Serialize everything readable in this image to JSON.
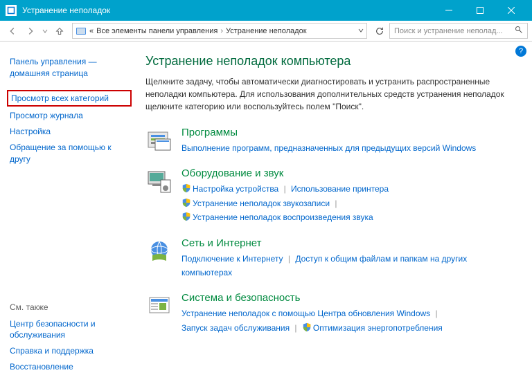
{
  "titlebar": {
    "title": "Устранение неполадок"
  },
  "navbar": {
    "breadcrumb0_sep": "«",
    "breadcrumb1": "Все элементы панели управления",
    "breadcrumb2": "Устранение неполадок",
    "search_placeholder": "Поиск и устранение неполад..."
  },
  "sidebar": {
    "home": "Панель управления — домашняя страница",
    "all_categories": "Просмотр всех категорий",
    "view_log": "Просмотр журнала",
    "settings": "Настройка",
    "ask_friend": "Обращение за помощью к другу",
    "see_also_header": "См. также",
    "security_center": "Центр безопасности и обслуживания",
    "help_support": "Справка и поддержка",
    "recovery": "Восстановление"
  },
  "main": {
    "heading": "Устранение неполадок компьютера",
    "description": "Щелкните задачу, чтобы автоматически диагностировать и устранить распространенные неполадки компьютера. Для использования дополнительных средств устранения неполадок щелкните категорию или воспользуйтесь полем \"Поиск\".",
    "help_tooltip": "?",
    "cat_programs": {
      "title": "Программы",
      "link1": "Выполнение программ, предназначенных для предыдущих версий Windows"
    },
    "cat_hardware": {
      "title": "Оборудование и звук",
      "link1": "Настройка устройства",
      "link2": "Использование принтера",
      "link3": "Устранение неполадок звукозаписи",
      "link4": "Устранение неполадок воспроизведения звука"
    },
    "cat_network": {
      "title": "Сеть и Интернет",
      "link1": "Подключение к Интернету",
      "link2": "Доступ к общим файлам и папкам на других компьютерах"
    },
    "cat_system": {
      "title": "Система и безопасность",
      "link1": "Устранение неполадок с помощью Центра обновления Windows",
      "link2": "Запуск задач обслуживания",
      "link3": "Оптимизация энергопотребления"
    }
  }
}
